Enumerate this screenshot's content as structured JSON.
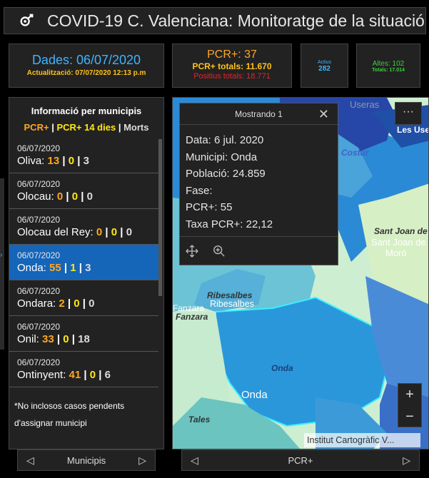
{
  "header": {
    "title": "COVID-19 C. Valenciana: Monitoratge de la situació"
  },
  "cards": {
    "dates": {
      "main": "Dades: 06/07/2020",
      "sub": "Actualització: 07/07/2020 12:13 p.m"
    },
    "pcr": {
      "main": "PCR+: 37",
      "totals": "PCR+ totals: 11.670",
      "positius": "Positius totals: 18.771"
    },
    "actius": {
      "label": "Actius",
      "value": "282"
    },
    "altes": {
      "label": "Altes: 102",
      "totals": "Totals: 17.014"
    }
  },
  "panel": {
    "title": "Informació per municipis",
    "legend": {
      "pcr": "PCR+",
      "sep": "|",
      "pcr14": "PCR+ 14 dies",
      "morts": "Morts"
    },
    "rows": [
      {
        "date": "06/07/2020",
        "name": "Oliva:",
        "pcr": "13",
        "pcr14": "0",
        "morts": "3"
      },
      {
        "date": "06/07/2020",
        "name": "Olocau:",
        "pcr": "0",
        "pcr14": "0",
        "morts": "0"
      },
      {
        "date": "06/07/2020",
        "name": "Olocau del Rey:",
        "pcr": "0",
        "pcr14": "0",
        "morts": "0"
      },
      {
        "date": "06/07/2020",
        "name": "Onda:",
        "pcr": "55",
        "pcr14": "1",
        "morts": "3"
      },
      {
        "date": "06/07/2020",
        "name": "Ondara:",
        "pcr": "2",
        "pcr14": "0",
        "morts": "0"
      },
      {
        "date": "06/07/2020",
        "name": "Onil:",
        "pcr": "33",
        "pcr14": "0",
        "morts": "18"
      },
      {
        "date": "06/07/2020",
        "name": "Ontinyent:",
        "pcr": "41",
        "pcr14": "0",
        "morts": "6"
      }
    ],
    "note": "*No inclosos casos pendents d'assignar municipi"
  },
  "bottom": {
    "left_label": "Municipis",
    "right_label": "PCR+"
  },
  "popup": {
    "header": "Mostrando 1",
    "lines": [
      "Data: 6 jul. 2020",
      "Municipi: Onda",
      "Població: 24.859",
      "Fase:",
      "PCR+: 55",
      "Taxa PCR+: 22,12"
    ]
  },
  "map": {
    "labels": [
      "Useras",
      "Les Use",
      "Costur",
      "Sant Joan de",
      "Sant Joan de",
      "Moró",
      "Ribesalbes",
      "Ribesalbes",
      "Fanzara",
      "Fanzara",
      "Onda",
      "Onda",
      "Tales"
    ],
    "attribution": "Institut Cartogràfic V...",
    "zoom_in": "+",
    "zoom_out": "−",
    "menu": "···"
  },
  "colors": {
    "selected": "#1565b9",
    "pcr": "#ffa722",
    "pcr14": "#ffe814",
    "blue": "#3fb4ff",
    "green": "#38d33a",
    "red": "#e0262b"
  }
}
